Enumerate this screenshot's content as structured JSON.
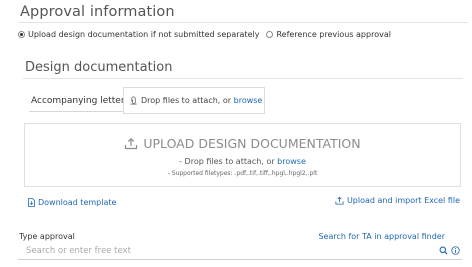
{
  "approval": {
    "title": "Approval information",
    "options": [
      {
        "label": "Upload design documentation if not submitted separately",
        "selected": true
      },
      {
        "label": "Reference previous approval",
        "selected": false
      }
    ]
  },
  "design": {
    "title": "Design documentation",
    "accompanying": {
      "label": "Accompanying letter",
      "drop_text": "Drop files to attach, or",
      "browse": "browse"
    },
    "upload": {
      "title": "UPLOAD DESIGN DOCUMENTATION",
      "drop_prefix": "- Drop files to attach, or",
      "browse": "browse",
      "filetypes": "- Supported filetypes: .pdf,.tif,.tiff,.hpgl,.hpgl2,.plt"
    },
    "download_template": "Download template",
    "upload_excel": "Upload and import Excel file"
  },
  "type_approval": {
    "label": "Type approval",
    "finder_link": "Search for TA in approval finder",
    "placeholder": "Search or enter free text",
    "value": ""
  },
  "colors": {
    "link": "#1f67b1",
    "muted_text": "#8c8c8c",
    "border": "#dcdcdc"
  },
  "icons": [
    "paperclip-icon",
    "upload-cloud-icon",
    "document-icon",
    "upload-icon",
    "search-icon",
    "info-icon"
  ]
}
